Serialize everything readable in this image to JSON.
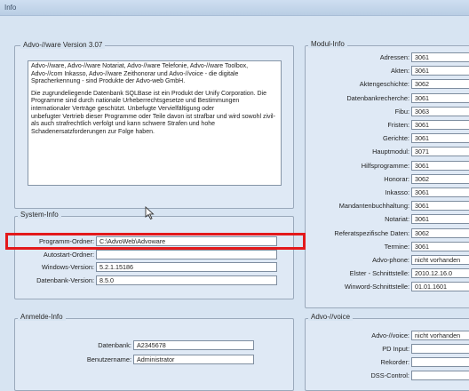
{
  "window": {
    "title": "Info"
  },
  "version_panel": {
    "title": "Advo-//ware Version 3.07",
    "paragraphs": [
      "Advo-//ware, Advo-//ware Notariat, Advo-//ware Telefonie, Advo-//ware Toolbox, Advo-//com Inkasso, Advo-//ware Zeithonorar und Advo-//voice - die digitale Spracherkennung - sind Produkte der Advo-web GmbH.",
      "Die zugrundeliegende Datenbank SQLBase ist ein Produkt der Unify Corporation. Die Programme sind durch nationale Urheberrechtsgesetze und Bestimmungen internationaler Verträge geschützt. Unbefugte Vervielfältigung oder",
      "unbefugter Vertrieb dieser Programme oder Teile davon ist strafbar und wird sowohl zivil- als auch strafrechtlich verfolgt und kann schwere Strafen und hohe Schadenersatzforderungen zur Folge haben."
    ]
  },
  "system_panel": {
    "title": "System-Info",
    "rows": [
      {
        "label": "Programm-Ordner:",
        "value": "C:\\AdvoWeb\\Advoware"
      },
      {
        "label": "Autostart-Ordner:",
        "value": ""
      },
      {
        "label": "Windows-Version:",
        "value": "5.2.1.15186"
      },
      {
        "label": "Datenbank-Version:",
        "value": "8.5.0"
      }
    ]
  },
  "anmelde_panel": {
    "title": "Anmelde-Info",
    "rows": [
      {
        "label": "Datenbank:",
        "value": "A2345678"
      },
      {
        "label": "Benutzername:",
        "value": "Administrator"
      }
    ]
  },
  "modul_panel": {
    "title": "Modul-Info",
    "rows": [
      {
        "label": "Adressen:",
        "value": "3061"
      },
      {
        "label": "Akten:",
        "value": "3061"
      },
      {
        "label": "Aktengeschichte:",
        "value": "3062"
      },
      {
        "label": "Datenbankrecherche:",
        "value": "3061"
      },
      {
        "label": "Fibu:",
        "value": "3063"
      },
      {
        "label": "Fristen:",
        "value": "3061"
      },
      {
        "label": "Gerichte:",
        "value": "3061"
      },
      {
        "label": "Hauptmodul:",
        "value": "3071"
      },
      {
        "label": "Hilfsprogramme:",
        "value": "3061"
      },
      {
        "label": "Honorar:",
        "value": "3062"
      },
      {
        "label": "Inkasso:",
        "value": "3061"
      },
      {
        "label": "Mandantenbuchhaltung:",
        "value": "3061"
      },
      {
        "label": "Notariat:",
        "value": "3061"
      },
      {
        "label": "Referatspezifische Daten:",
        "value": "3062"
      },
      {
        "label": "Termine:",
        "value": "3061"
      },
      {
        "label": "Advo-phone:",
        "value": "nicht vorhanden"
      },
      {
        "label": "Elster - Schnittstelle:",
        "value": "2010.12.16.0"
      },
      {
        "label": "Winword-Schnittstelle:",
        "value": "01.01.1601"
      }
    ]
  },
  "voice_panel": {
    "title": "Advo-//voice",
    "rows": [
      {
        "label": "Advo-//voice:",
        "value": "nicht vorhanden"
      },
      {
        "label": "PD Input:",
        "value": ""
      },
      {
        "label": "Rekorder:",
        "value": ""
      },
      {
        "label": "DSS-Control:",
        "value": ""
      }
    ]
  },
  "colors": {
    "highlight": "#e3191b",
    "background": "#d7e4f2"
  },
  "icons": {
    "cursor": "mouse-pointer-icon"
  }
}
